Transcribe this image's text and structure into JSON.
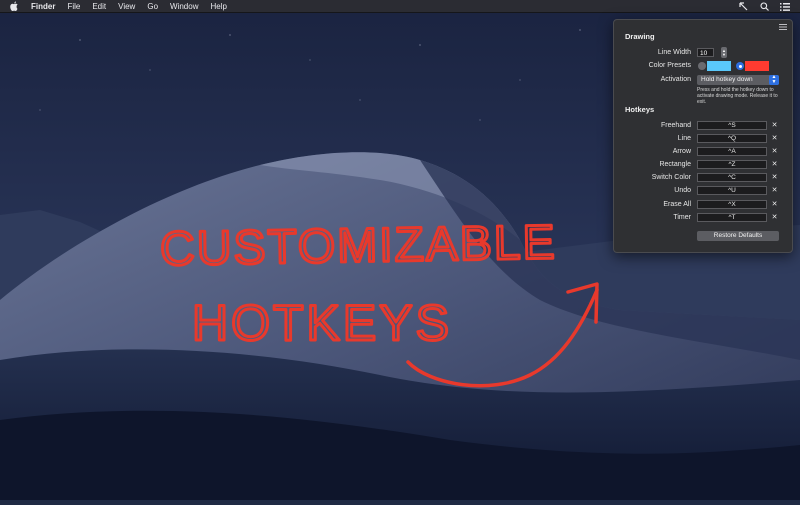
{
  "menubar": {
    "app_name": "Finder",
    "items": [
      "File",
      "Edit",
      "View",
      "Go",
      "Window",
      "Help"
    ]
  },
  "icons": {
    "apple": "apple-icon",
    "app_status": "arrow-cursor-icon",
    "search": "magnifier-icon",
    "list": "list-icon",
    "menu": "hamburger-icon"
  },
  "popover": {
    "drawing": {
      "title": "Drawing",
      "line_width_label": "Line Width",
      "line_width_value": "10",
      "color_presets_label": "Color Presets",
      "presets": [
        {
          "color": "#5ac8fa",
          "selected": false
        },
        {
          "color": "#ff3b30",
          "selected": true
        }
      ],
      "activation_label": "Activation",
      "activation_value": "Hold hotkey down",
      "activation_help": "Press and hold the hotkey down to activate drawing mode. Release it to exit."
    },
    "hotkeys": {
      "title": "Hotkeys",
      "items": [
        {
          "label": "Freehand",
          "key": "^S"
        },
        {
          "label": "Line",
          "key": "^Q"
        },
        {
          "label": "Arrow",
          "key": "^A"
        },
        {
          "label": "Rectangle",
          "key": "^Z"
        },
        {
          "label": "Switch Color",
          "key": "^C"
        },
        {
          "label": "Undo",
          "key": "^U"
        },
        {
          "label": "Erase All",
          "key": "^X"
        },
        {
          "label": "Timer",
          "key": "^T"
        }
      ],
      "clear_glyph": "✕"
    },
    "restore_label": "Restore Defaults"
  },
  "annotation": {
    "line1": "CUSTOMIZABLE",
    "line2": "HOTKEYS",
    "color": "#e8392c"
  },
  "colors": {
    "accent": "#2d6fe0",
    "ink": "#e8392c"
  }
}
